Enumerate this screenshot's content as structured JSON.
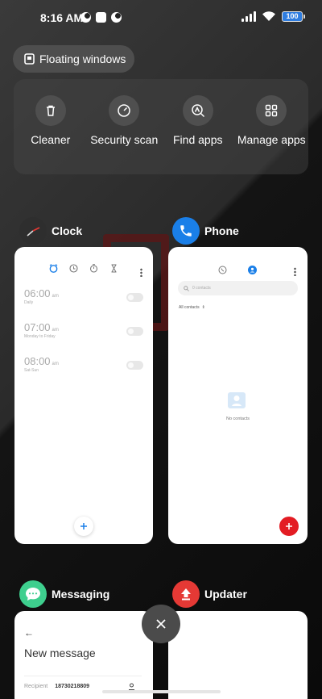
{
  "status_bar": {
    "time": "8:16 AM",
    "battery": "100"
  },
  "floating_windows": {
    "label": "Floating windows"
  },
  "tools": [
    {
      "label": "Cleaner",
      "icon": "trash-icon"
    },
    {
      "label": "Security scan",
      "icon": "gauge-icon"
    },
    {
      "label": "Find apps",
      "icon": "find-apps-icon"
    },
    {
      "label": "Manage apps",
      "icon": "grid-icon"
    }
  ],
  "apps": [
    {
      "name": "Clock",
      "icon": "clock-icon"
    },
    {
      "name": "Phone",
      "icon": "phone-icon"
    },
    {
      "name": "Messaging",
      "icon": "messaging-icon"
    },
    {
      "name": "Updater",
      "icon": "updater-icon"
    }
  ],
  "clock": {
    "alarms": [
      {
        "time": "06:00",
        "ampm": "am",
        "sub": "Daily"
      },
      {
        "time": "07:00",
        "ampm": "am",
        "sub": "Monday to Friday"
      },
      {
        "time": "08:00",
        "ampm": "am",
        "sub": "Sat-Sun"
      }
    ]
  },
  "phone": {
    "search_placeholder": "0 contacts",
    "filter": "All contacts",
    "empty": "No contacts"
  },
  "messaging": {
    "title": "New message",
    "recipient_label": "Recipient",
    "recipient_value": "18730218809"
  },
  "colors": {
    "accent_blue": "#1a7fe8",
    "fab_red": "#e31c23",
    "messaging_green": "#3ecf8e",
    "updater_red": "#e53935"
  }
}
